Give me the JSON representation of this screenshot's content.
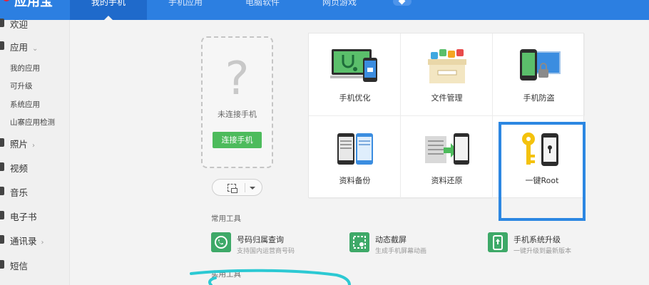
{
  "app": {
    "title": "应用宝"
  },
  "nav": {
    "tabs": [
      {
        "label": "我的手机",
        "active": true
      },
      {
        "label": "手机应用",
        "active": false
      },
      {
        "label": "电脑软件",
        "active": false
      },
      {
        "label": "网页游戏",
        "active": false
      }
    ]
  },
  "sidebar": {
    "items": [
      {
        "label": "欢迎",
        "level": "main"
      },
      {
        "label": "应用",
        "level": "main",
        "arrow": "⌄"
      },
      {
        "label": "我的应用",
        "level": "sub"
      },
      {
        "label": "可升级",
        "level": "sub"
      },
      {
        "label": "系统应用",
        "level": "sub"
      },
      {
        "label": "山寨应用检测",
        "level": "sub"
      },
      {
        "label": "照片",
        "level": "main",
        "arrow": "›"
      },
      {
        "label": "视频",
        "level": "main"
      },
      {
        "label": "音乐",
        "level": "main"
      },
      {
        "label": "电子书",
        "level": "main"
      },
      {
        "label": "通讯录",
        "level": "main",
        "arrow": "›"
      },
      {
        "label": "短信",
        "level": "main"
      }
    ]
  },
  "phone": {
    "placeholder_glyph": "?",
    "status": "未连接手机",
    "connect_label": "连接手机"
  },
  "tools": [
    {
      "label": "手机优化",
      "icon": "phone-optimize-icon"
    },
    {
      "label": "文件管理",
      "icon": "file-manager-icon"
    },
    {
      "label": "手机防盗",
      "icon": "phone-antitheft-icon"
    },
    {
      "label": "资料备份",
      "icon": "data-backup-icon"
    },
    {
      "label": "资料还原",
      "icon": "data-restore-icon"
    },
    {
      "label": "一键Root",
      "icon": "root-key-icon",
      "highlighted": true
    }
  ],
  "common_tools": {
    "title": "常用工具",
    "items": [
      {
        "name": "号码归属查询",
        "desc": "支持国内运营商号码",
        "icon": "phone-lookup-icon"
      },
      {
        "name": "动态截屏",
        "desc": "生成手机屏幕动画",
        "icon": "screen-capture-icon"
      },
      {
        "name": "手机系统升级",
        "desc": "一键升级到最新版本",
        "icon": "system-upgrade-icon"
      }
    ]
  },
  "practical_tools": {
    "title": "实用工具"
  },
  "colors": {
    "topbar": "#2c7fe1",
    "active_tab": "#1f6acb",
    "connect_button": "#4dbb5c",
    "highlight_border": "#2c87e2",
    "annotation": "#2cc9d3"
  }
}
